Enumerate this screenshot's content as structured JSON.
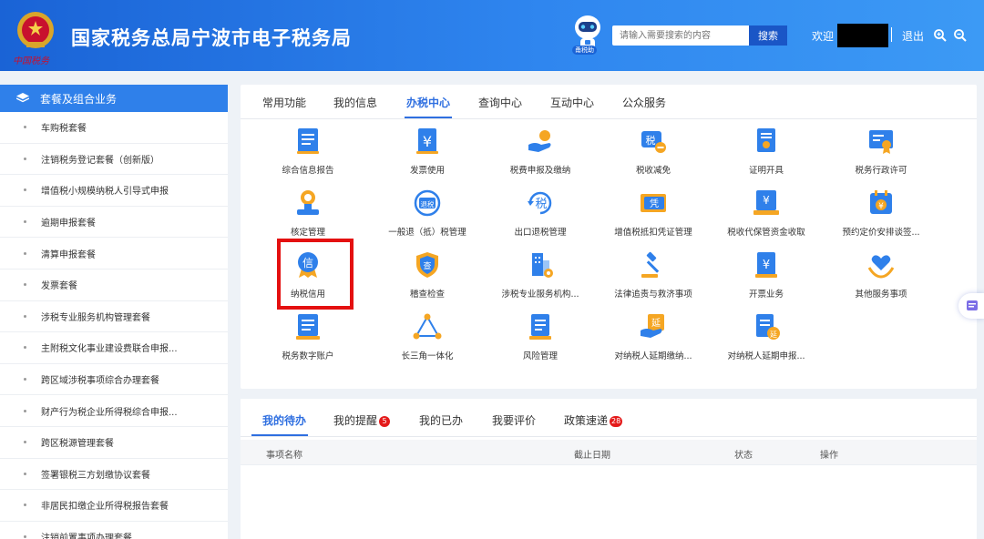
{
  "header": {
    "title": "国家税务总局宁波市电子税务局",
    "emblem_signature": "中国税务",
    "robot_label": "甬税助",
    "search_placeholder": "请输入需要搜索的内容",
    "search_button": "搜索",
    "welcome": "欢迎",
    "logout": "退出",
    "colors": {
      "header_start": "#1a63d6",
      "header_end": "#3c9af5"
    }
  },
  "sidebar": {
    "title": "套餐及组合业务",
    "items": [
      "车购税套餐",
      "注销税务登记套餐（创新版）",
      "增值税小规模纳税人引导式申报",
      "逾期申报套餐",
      "清算申报套餐",
      "发票套餐",
      "涉税专业服务机构管理套餐",
      "主附税文化事业建设费联合申报...",
      "跨区域涉税事项综合办理套餐",
      "财产行为税企业所得税综合申报...",
      "跨区税源管理套餐",
      "签署银税三方划缴协议套餐",
      "非居民扣缴企业所得税报告套餐",
      "注销前置事项办理套餐"
    ]
  },
  "main": {
    "tabs": [
      "常用功能",
      "我的信息",
      "办税中心",
      "查询中心",
      "互动中心",
      "公众服务"
    ],
    "active_tab": "办税中心",
    "services": [
      {
        "label": "综合信息报告",
        "icon": "document-icon"
      },
      {
        "label": "发票使用",
        "icon": "invoice-yen-icon"
      },
      {
        "label": "税费申报及缴纳",
        "icon": "hand-coin-icon"
      },
      {
        "label": "税收减免",
        "icon": "tax-reduction-icon"
      },
      {
        "label": "证明开具",
        "icon": "certificate-icon"
      },
      {
        "label": "税务行政许可",
        "icon": "license-icon"
      },
      {
        "label": "核定管理",
        "icon": "stamp-icon"
      },
      {
        "label": "一般退（抵）税管理",
        "icon": "refund-icon"
      },
      {
        "label": "出口退税管理",
        "icon": "export-tax-icon"
      },
      {
        "label": "增值税抵扣凭证管理",
        "icon": "voucher-icon"
      },
      {
        "label": "税收代保管资金收取",
        "icon": "custody-fund-icon"
      },
      {
        "label": "预约定价安排谈签...",
        "icon": "calendar-yen-icon"
      },
      {
        "label": "纳税信用",
        "icon": "credit-medal-icon"
      },
      {
        "label": "稽查检查",
        "icon": "inspection-shield-icon"
      },
      {
        "label": "涉税专业服务机构...",
        "icon": "agency-building-icon"
      },
      {
        "label": "法律追责与救济事项",
        "icon": "gavel-icon"
      },
      {
        "label": "开票业务",
        "icon": "billing-icon"
      },
      {
        "label": "其他服务事项",
        "icon": "heart-hand-icon"
      },
      {
        "label": "税务数字账户",
        "icon": "digital-account-icon"
      },
      {
        "label": "长三角一体化",
        "icon": "triangle-network-icon"
      },
      {
        "label": "风险管理",
        "icon": "risk-doc-icon"
      },
      {
        "label": "对纳税人延期缴纳...",
        "icon": "deferral-pay-icon"
      },
      {
        "label": "对纳税人延期申报...",
        "icon": "deferral-declare-icon"
      }
    ],
    "icon_text": {
      "tax": "税",
      "refund": "退税",
      "voucher": "凭",
      "credit": "信",
      "inspect": "查",
      "defer": "延"
    }
  },
  "bottom": {
    "tabs": [
      {
        "label": "我的待办",
        "badge": ""
      },
      {
        "label": "我的提醒",
        "badge": "5"
      },
      {
        "label": "我的已办",
        "badge": ""
      },
      {
        "label": "我要评价",
        "badge": ""
      },
      {
        "label": "政策速递",
        "badge": "28"
      }
    ],
    "columns": [
      "事项名称",
      "截止日期",
      "状态",
      "操作"
    ]
  },
  "colors": {
    "accent": "#2f6fe0",
    "highlight": "#e41010",
    "badge": "#e41b1b"
  }
}
